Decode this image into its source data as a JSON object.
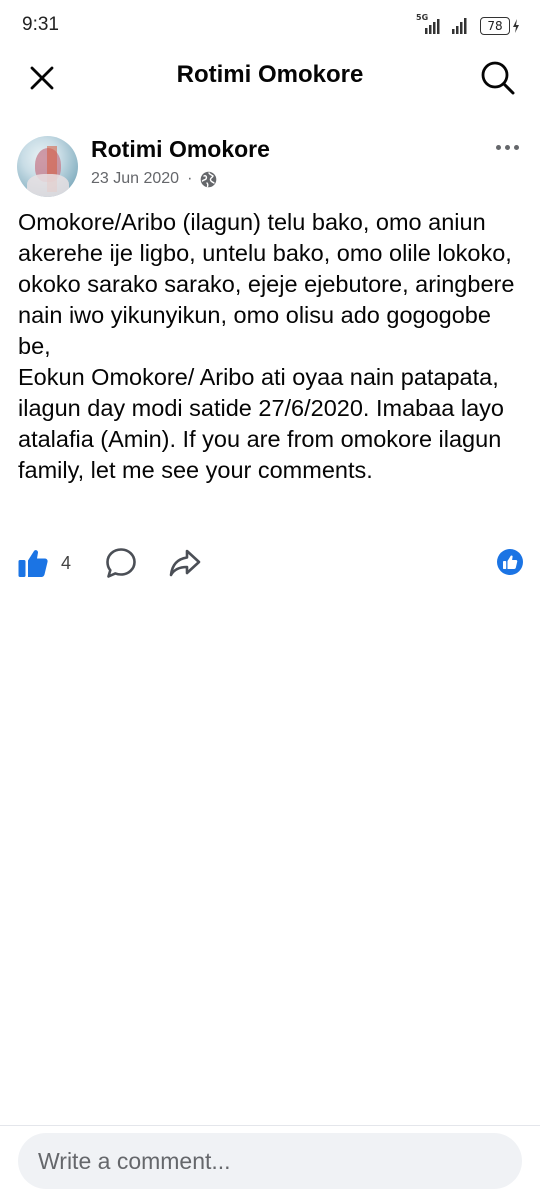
{
  "status_bar": {
    "time": "9:31",
    "network_label": "5G",
    "battery_level": "78"
  },
  "nav": {
    "title": "Rotimi Omokore",
    "close_icon": "close-icon",
    "search_icon": "search-icon"
  },
  "post": {
    "author": "Rotimi Omokore",
    "date": "23 Jun 2020",
    "meta_separator": "·",
    "audience_icon": "globe-icon",
    "body": "Omokore/Aribo (ilagun) telu bako, omo aniun akerehe ije ligbo, untelu bako, omo olile lokoko, okoko sarako sarako, ejeje ejebutore, aringbere nain iwo yikunyikun, omo olisu ado gogogobe be,\nEokun Omokore/ Aribo ati oyaa nain patapata, ilagun day modi satide 27/6/2020. Imabaa layo atalafia (Amin). If you are from omokore ilagun family, let me see your comments."
  },
  "actions": {
    "like_count": "4",
    "like_icon": "thumbs-up-icon",
    "comment_icon": "comment-icon",
    "share_icon": "share-icon",
    "reaction_icon": "like-reaction-icon"
  },
  "comment_box": {
    "placeholder": "Write a comment..."
  },
  "colors": {
    "accent": "#1b74e4",
    "text": "#050505",
    "secondary_text": "#65676b",
    "input_bg": "#f0f2f5"
  }
}
